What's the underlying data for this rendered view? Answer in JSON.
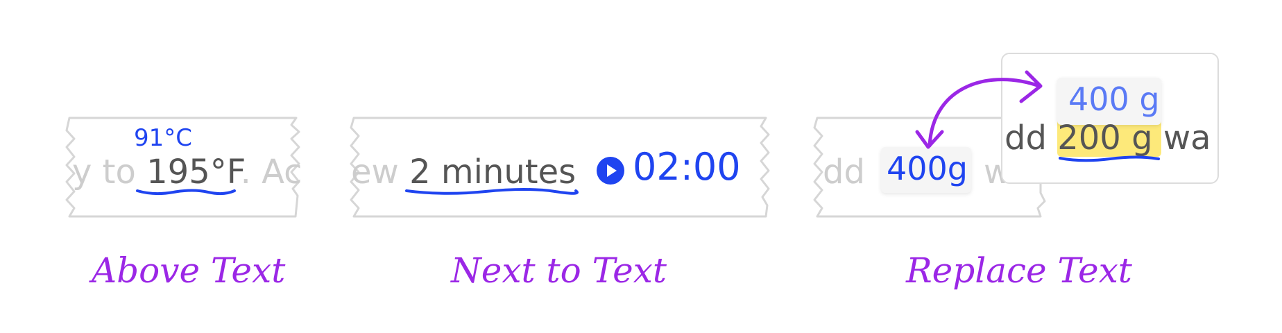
{
  "colors": {
    "ink": "#1f44f0",
    "caption": "#9b27e6",
    "faded_text": "#cdcdcd",
    "strong_text": "#555555",
    "highlight": "#fde97a",
    "border": "#dcdcdc"
  },
  "panels": [
    {
      "caption": "Above Text",
      "left_fade": "y to",
      "target": "195°F",
      "right_fade": ". Ac",
      "annotation": "91°C"
    },
    {
      "caption": "Next to Text",
      "left_fade": "ew",
      "target": "2 minutes",
      "timer_icon": "play-icon",
      "annotation": "02:00"
    },
    {
      "caption": "Replace Text",
      "left_fade": "dd",
      "annotation": "400g",
      "right_fade": "w",
      "popup": {
        "before": "dd",
        "target": "200 g",
        "after": "wa",
        "annotation": "400 g"
      }
    }
  ]
}
